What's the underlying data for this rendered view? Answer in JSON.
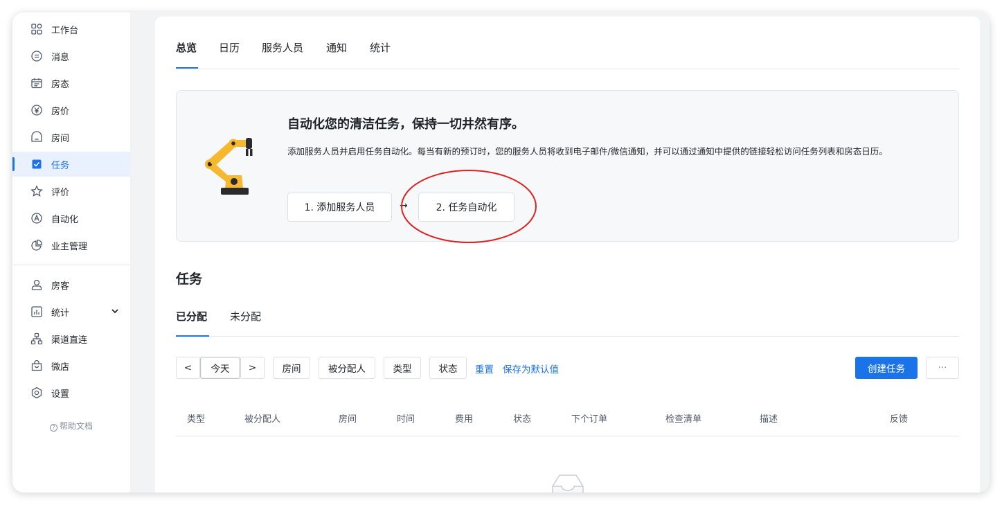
{
  "sidebar": {
    "items": [
      {
        "label": "工作台",
        "icon": "dashboard-icon"
      },
      {
        "label": "消息",
        "icon": "message-icon"
      },
      {
        "label": "房态",
        "icon": "calendar-icon"
      },
      {
        "label": "房价",
        "icon": "yen-icon"
      },
      {
        "label": "房间",
        "icon": "room-icon"
      },
      {
        "label": "任务",
        "icon": "checkbox-icon",
        "active": true
      },
      {
        "label": "评价",
        "icon": "star-icon"
      },
      {
        "label": "自动化",
        "icon": "automation-icon"
      },
      {
        "label": "业主管理",
        "icon": "pie-icon"
      },
      {
        "label": "房客",
        "icon": "user-icon"
      },
      {
        "label": "统计",
        "icon": "chart-icon",
        "has_chevron": true
      },
      {
        "label": "渠道直连",
        "icon": "network-icon"
      },
      {
        "label": "微店",
        "icon": "shop-bag-icon"
      },
      {
        "label": "设置",
        "icon": "settings-icon"
      }
    ],
    "help_label": "帮助文档"
  },
  "top_tabs": [
    "总览",
    "日历",
    "服务人员",
    "通知",
    "统计"
  ],
  "banner": {
    "title": "自动化您的清洁任务，保持一切井然有序。",
    "description": "添加服务人员并启用任务自动化。每当有新的预订时，您的服务人员将收到电子邮件/微信通知，并可以通过通知中提供的链接轻松访问任务列表和房态日历。",
    "step1": "1. 添加服务人员",
    "arrow": "→",
    "step2": "2. 任务自动化"
  },
  "section_title": "任务",
  "sub_tabs": [
    "已分配",
    "未分配"
  ],
  "toolbar": {
    "prev": "<",
    "today": "今天",
    "next": ">",
    "filter_room": "房间",
    "filter_assignee": "被分配人",
    "filter_type": "类型",
    "filter_status": "状态",
    "reset": "重置",
    "save_default": "保存为默认值",
    "create": "创建任务",
    "more": "···"
  },
  "table": {
    "columns": [
      "类型",
      "被分配人",
      "房间",
      "时间",
      "费用",
      "状态",
      "下个订单",
      "检查清单",
      "描述",
      "反馈"
    ]
  },
  "colors": {
    "accent": "#1a73e8",
    "highlight_circle": "#e02020"
  }
}
